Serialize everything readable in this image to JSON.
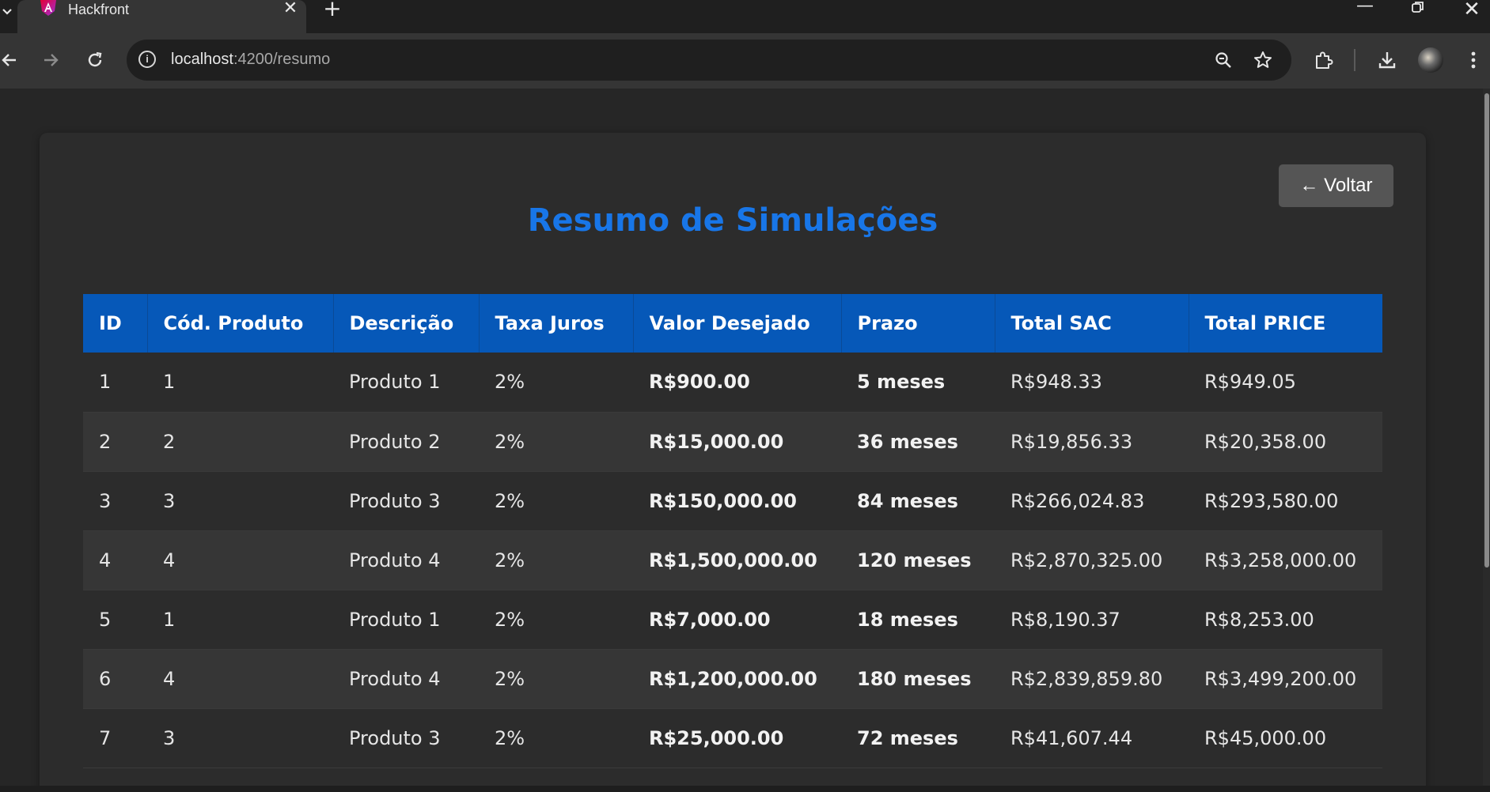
{
  "browser": {
    "tab": {
      "title": "Hackfront",
      "favicon": "angular-logo-icon"
    },
    "url": {
      "host": "localhost",
      "path": ":4200/resumo"
    }
  },
  "page": {
    "back_label": "← Voltar",
    "title": "Resumo de Simulações",
    "table": {
      "headers": [
        "ID",
        "Cód. Produto",
        "Descrição",
        "Taxa Juros",
        "Valor Desejado",
        "Prazo",
        "Total SAC",
        "Total PRICE"
      ],
      "rows": [
        {
          "id": "1",
          "cod": "1",
          "desc": "Produto 1",
          "taxa": "2%",
          "valor": "R$900.00",
          "prazo": "5 meses",
          "sac": "R$948.33",
          "price": "R$949.05"
        },
        {
          "id": "2",
          "cod": "2",
          "desc": "Produto 2",
          "taxa": "2%",
          "valor": "R$15,000.00",
          "prazo": "36 meses",
          "sac": "R$19,856.33",
          "price": "R$20,358.00"
        },
        {
          "id": "3",
          "cod": "3",
          "desc": "Produto 3",
          "taxa": "2%",
          "valor": "R$150,000.00",
          "prazo": "84 meses",
          "sac": "R$266,024.83",
          "price": "R$293,580.00"
        },
        {
          "id": "4",
          "cod": "4",
          "desc": "Produto 4",
          "taxa": "2%",
          "valor": "R$1,500,000.00",
          "prazo": "120 meses",
          "sac": "R$2,870,325.00",
          "price": "R$3,258,000.00"
        },
        {
          "id": "5",
          "cod": "1",
          "desc": "Produto 1",
          "taxa": "2%",
          "valor": "R$7,000.00",
          "prazo": "18 meses",
          "sac": "R$8,190.37",
          "price": "R$8,253.00"
        },
        {
          "id": "6",
          "cod": "4",
          "desc": "Produto 4",
          "taxa": "2%",
          "valor": "R$1,200,000.00",
          "prazo": "180 meses",
          "sac": "R$2,839,859.80",
          "price": "R$3,499,200.00"
        },
        {
          "id": "7",
          "cod": "3",
          "desc": "Produto 3",
          "taxa": "2%",
          "valor": "R$25,000.00",
          "prazo": "72 meses",
          "sac": "R$41,607.44",
          "price": "R$45,000.00"
        }
      ]
    }
  },
  "colors": {
    "title": "#1876e8",
    "header_bg": "#0658b8",
    "button_bg": "#555555",
    "card_bg": "#2c2c2c"
  }
}
